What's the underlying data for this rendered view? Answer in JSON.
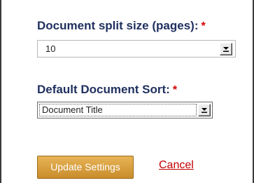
{
  "split_size": {
    "label": "Document split size (pages):",
    "required_marker": "*",
    "selected_value": "10"
  },
  "document_sort": {
    "label": "Default Document Sort:",
    "required_marker": "*",
    "selected_value": "Document Title"
  },
  "actions": {
    "update_label": "Update Settings",
    "cancel_label": "Cancel"
  },
  "colors": {
    "label_text": "#1f2f5e",
    "required": "#d60000",
    "button_top": "#e7b456",
    "button_bottom": "#c98c2c",
    "cancel_link": "#c00000"
  },
  "icons": {
    "dropdown_arrow": "chevron-down-icon"
  }
}
